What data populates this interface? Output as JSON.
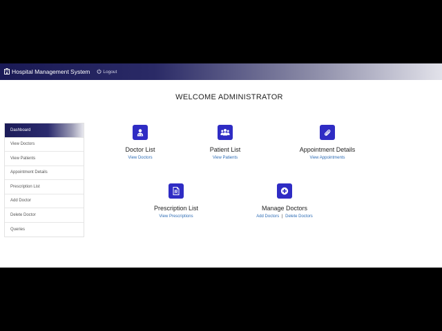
{
  "navbar": {
    "brand": "Hospital Management System",
    "logout": "Logout"
  },
  "welcome": "WELCOME ADMINISTRATOR",
  "sidebar": {
    "items": [
      {
        "label": "Dashboard",
        "active": true
      },
      {
        "label": "View Doctors"
      },
      {
        "label": "View Patients"
      },
      {
        "label": "Appointment Details"
      },
      {
        "label": "Prescription List"
      },
      {
        "label": "Add Doctor"
      },
      {
        "label": "Delete Doctor"
      },
      {
        "label": "Queries"
      }
    ]
  },
  "cards": {
    "doctor": {
      "title": "Doctor List",
      "link": "View Doctors",
      "icon": "doctor-icon"
    },
    "patient": {
      "title": "Patient List",
      "link": "View Patients",
      "icon": "users-icon"
    },
    "appointment": {
      "title": "Appointment Details",
      "link": "View Appointments",
      "icon": "paperclip-icon"
    },
    "prescription": {
      "title": "Prescription List",
      "link": "View Prescriptions",
      "icon": "prescription-file-icon"
    },
    "manage": {
      "title": "Manage Doctors",
      "link_add": "Add Doctors",
      "separator": "|",
      "link_delete": "Delete Doctors",
      "icon": "plus-circle-icon"
    }
  },
  "colors": {
    "accent": "#2f2cc4",
    "navbar_dark": "#1a1a55",
    "link": "#2d6cb5"
  }
}
